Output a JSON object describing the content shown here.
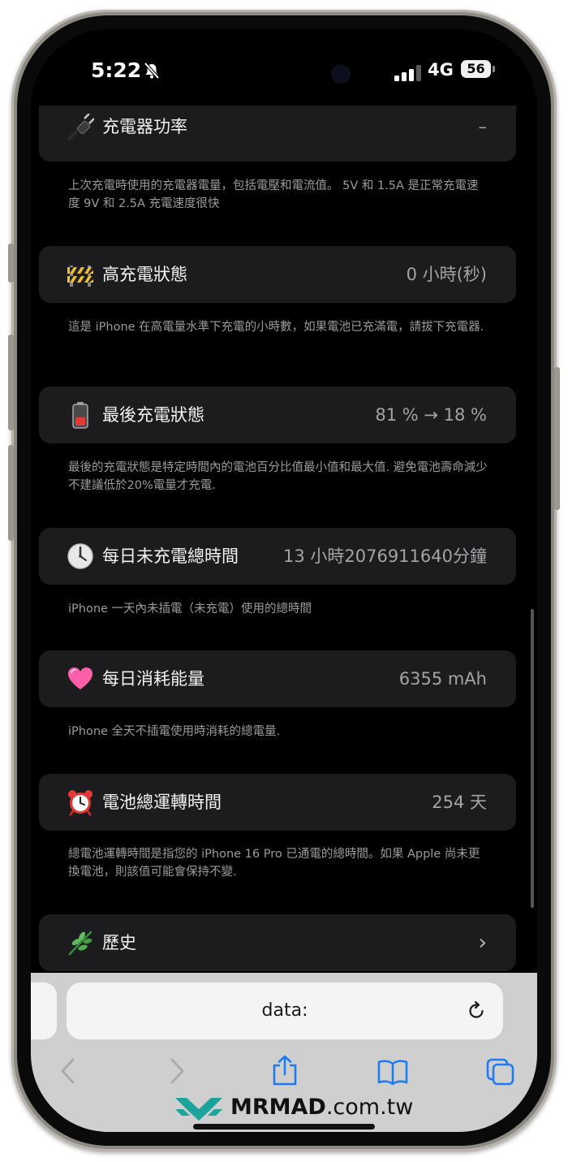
{
  "status": {
    "time": "5:22",
    "network": "4G",
    "battery": "56"
  },
  "cards": [
    {
      "icon": "plug-icon",
      "title": "充電器功率",
      "value": "–",
      "desc": "上次充電時使用的充電器電量，包括電壓和電流值。 5V 和 1.5A 是正常充電速度 9V 和 2.5A 充電速度很快"
    },
    {
      "icon": "construction-barrier-icon",
      "title": "高充電狀態",
      "value": "0 小時(秒)",
      "desc": "這是 iPhone 在高電量水準下充電的小時數，如果電池已充滿電，請拔下充電器."
    },
    {
      "icon": "low-battery-icon",
      "title": "最後充電狀態",
      "value": "81 % → 18 %",
      "desc": "最後的充電狀態是特定時間內的電池百分比值最小值和最大值. 避免電池壽命減少不建議低於20%電量才充電."
    },
    {
      "icon": "clock-icon",
      "title": "每日未充電總時間",
      "value": "13 小時2076911640分鐘",
      "desc": "iPhone 一天內未插電（未充電）使用的總時間"
    },
    {
      "icon": "heart-icon",
      "title": "每日消耗能量",
      "value": "6355 mAh",
      "desc": "iPhone 全天不插電使用時消耗的總電量."
    },
    {
      "icon": "alarm-clock-icon",
      "title": "電池總運轉時間",
      "value": "254 天",
      "desc": "總電池運轉時間是指您的 iPhone 16 Pro 已通電的總時間。如果 Apple 尚未更換電池，則該值可能會保持不變."
    }
  ],
  "history": {
    "title": "歷史",
    "chevron": "›"
  },
  "browser": {
    "url": "data:"
  },
  "watermark": {
    "brand": "MRMAD",
    "domain": ".com.tw"
  }
}
